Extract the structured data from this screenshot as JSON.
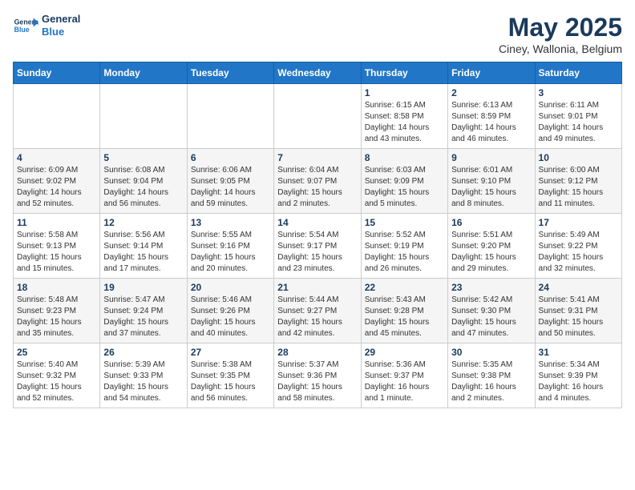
{
  "header": {
    "logo_general": "General",
    "logo_blue": "Blue",
    "month_title": "May 2025",
    "location": "Ciney, Wallonia, Belgium"
  },
  "days_of_week": [
    "Sunday",
    "Monday",
    "Tuesday",
    "Wednesday",
    "Thursday",
    "Friday",
    "Saturday"
  ],
  "weeks": [
    [
      {
        "num": "",
        "info": ""
      },
      {
        "num": "",
        "info": ""
      },
      {
        "num": "",
        "info": ""
      },
      {
        "num": "",
        "info": ""
      },
      {
        "num": "1",
        "info": "Sunrise: 6:15 AM\nSunset: 8:58 PM\nDaylight: 14 hours\nand 43 minutes."
      },
      {
        "num": "2",
        "info": "Sunrise: 6:13 AM\nSunset: 8:59 PM\nDaylight: 14 hours\nand 46 minutes."
      },
      {
        "num": "3",
        "info": "Sunrise: 6:11 AM\nSunset: 9:01 PM\nDaylight: 14 hours\nand 49 minutes."
      }
    ],
    [
      {
        "num": "4",
        "info": "Sunrise: 6:09 AM\nSunset: 9:02 PM\nDaylight: 14 hours\nand 52 minutes."
      },
      {
        "num": "5",
        "info": "Sunrise: 6:08 AM\nSunset: 9:04 PM\nDaylight: 14 hours\nand 56 minutes."
      },
      {
        "num": "6",
        "info": "Sunrise: 6:06 AM\nSunset: 9:05 PM\nDaylight: 14 hours\nand 59 minutes."
      },
      {
        "num": "7",
        "info": "Sunrise: 6:04 AM\nSunset: 9:07 PM\nDaylight: 15 hours\nand 2 minutes."
      },
      {
        "num": "8",
        "info": "Sunrise: 6:03 AM\nSunset: 9:09 PM\nDaylight: 15 hours\nand 5 minutes."
      },
      {
        "num": "9",
        "info": "Sunrise: 6:01 AM\nSunset: 9:10 PM\nDaylight: 15 hours\nand 8 minutes."
      },
      {
        "num": "10",
        "info": "Sunrise: 6:00 AM\nSunset: 9:12 PM\nDaylight: 15 hours\nand 11 minutes."
      }
    ],
    [
      {
        "num": "11",
        "info": "Sunrise: 5:58 AM\nSunset: 9:13 PM\nDaylight: 15 hours\nand 15 minutes."
      },
      {
        "num": "12",
        "info": "Sunrise: 5:56 AM\nSunset: 9:14 PM\nDaylight: 15 hours\nand 17 minutes."
      },
      {
        "num": "13",
        "info": "Sunrise: 5:55 AM\nSunset: 9:16 PM\nDaylight: 15 hours\nand 20 minutes."
      },
      {
        "num": "14",
        "info": "Sunrise: 5:54 AM\nSunset: 9:17 PM\nDaylight: 15 hours\nand 23 minutes."
      },
      {
        "num": "15",
        "info": "Sunrise: 5:52 AM\nSunset: 9:19 PM\nDaylight: 15 hours\nand 26 minutes."
      },
      {
        "num": "16",
        "info": "Sunrise: 5:51 AM\nSunset: 9:20 PM\nDaylight: 15 hours\nand 29 minutes."
      },
      {
        "num": "17",
        "info": "Sunrise: 5:49 AM\nSunset: 9:22 PM\nDaylight: 15 hours\nand 32 minutes."
      }
    ],
    [
      {
        "num": "18",
        "info": "Sunrise: 5:48 AM\nSunset: 9:23 PM\nDaylight: 15 hours\nand 35 minutes."
      },
      {
        "num": "19",
        "info": "Sunrise: 5:47 AM\nSunset: 9:24 PM\nDaylight: 15 hours\nand 37 minutes."
      },
      {
        "num": "20",
        "info": "Sunrise: 5:46 AM\nSunset: 9:26 PM\nDaylight: 15 hours\nand 40 minutes."
      },
      {
        "num": "21",
        "info": "Sunrise: 5:44 AM\nSunset: 9:27 PM\nDaylight: 15 hours\nand 42 minutes."
      },
      {
        "num": "22",
        "info": "Sunrise: 5:43 AM\nSunset: 9:28 PM\nDaylight: 15 hours\nand 45 minutes."
      },
      {
        "num": "23",
        "info": "Sunrise: 5:42 AM\nSunset: 9:30 PM\nDaylight: 15 hours\nand 47 minutes."
      },
      {
        "num": "24",
        "info": "Sunrise: 5:41 AM\nSunset: 9:31 PM\nDaylight: 15 hours\nand 50 minutes."
      }
    ],
    [
      {
        "num": "25",
        "info": "Sunrise: 5:40 AM\nSunset: 9:32 PM\nDaylight: 15 hours\nand 52 minutes."
      },
      {
        "num": "26",
        "info": "Sunrise: 5:39 AM\nSunset: 9:33 PM\nDaylight: 15 hours\nand 54 minutes."
      },
      {
        "num": "27",
        "info": "Sunrise: 5:38 AM\nSunset: 9:35 PM\nDaylight: 15 hours\nand 56 minutes."
      },
      {
        "num": "28",
        "info": "Sunrise: 5:37 AM\nSunset: 9:36 PM\nDaylight: 15 hours\nand 58 minutes."
      },
      {
        "num": "29",
        "info": "Sunrise: 5:36 AM\nSunset: 9:37 PM\nDaylight: 16 hours\nand 1 minute."
      },
      {
        "num": "30",
        "info": "Sunrise: 5:35 AM\nSunset: 9:38 PM\nDaylight: 16 hours\nand 2 minutes."
      },
      {
        "num": "31",
        "info": "Sunrise: 5:34 AM\nSunset: 9:39 PM\nDaylight: 16 hours\nand 4 minutes."
      }
    ]
  ]
}
